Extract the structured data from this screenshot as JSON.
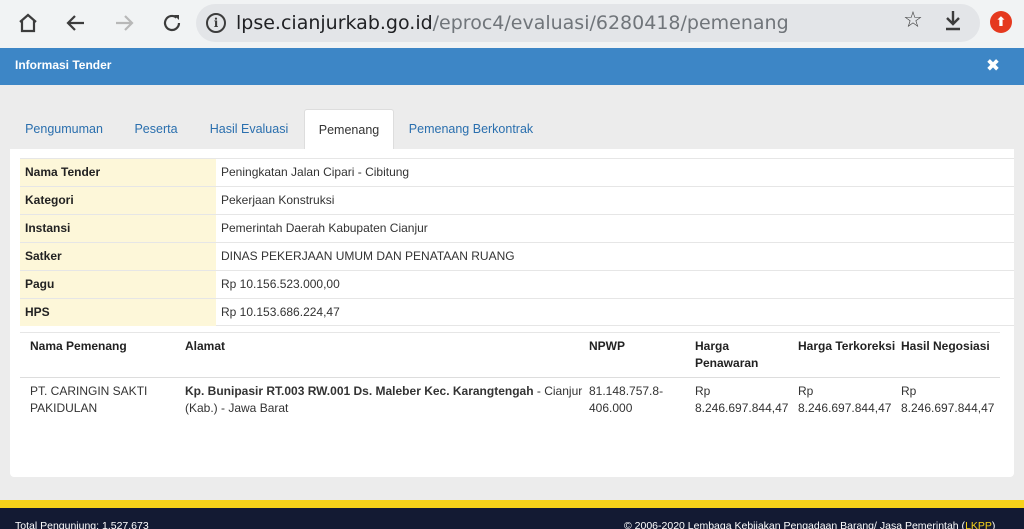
{
  "browser": {
    "url_host": "lpse.cianjurkab.go.id",
    "url_path": "/eproc4/evaluasi/6280418/pemenang",
    "icons": [
      "home-icon",
      "back-icon",
      "forward-icon",
      "reload-icon",
      "info-icon",
      "star-icon",
      "download-icon",
      "opera-icon"
    ]
  },
  "modal": {
    "title": "Informasi Tender",
    "close_glyph": "✖",
    "header_color": "#3d86c6"
  },
  "tabs": [
    {
      "label": "Pengumuman",
      "active": false
    },
    {
      "label": "Peserta",
      "active": false
    },
    {
      "label": "Hasil Evaluasi",
      "active": false
    },
    {
      "label": "Pemenang",
      "active": true
    },
    {
      "label": "Pemenang Berkontrak",
      "active": false
    }
  ],
  "info": [
    {
      "label": "Nama Tender",
      "value": "Peningkatan Jalan Cipari - Cibitung"
    },
    {
      "label": "Kategori",
      "value": "Pekerjaan Konstruksi"
    },
    {
      "label": "Instansi",
      "value": "Pemerintah Daerah Kabupaten Cianjur"
    },
    {
      "label": "Satker",
      "value": "DINAS PEKERJAAN UMUM DAN PENATAAN RUANG"
    },
    {
      "label": "Pagu",
      "value": "Rp 10.156.523.000,00"
    },
    {
      "label": "HPS",
      "value": "Rp 10.153.686.224,47"
    }
  ],
  "winners": {
    "headers": {
      "name": "Nama Pemenang",
      "address": "Alamat",
      "npwp": "NPWP",
      "offer_1": "Harga",
      "offer_2": "Penawaran",
      "corrected": "Harga Terkoreksi",
      "negotiated": "Hasil Negosiasi"
    },
    "rows": [
      {
        "name_1": "PT. CARINGIN SAKTI",
        "name_2": "PAKIDULAN",
        "address_bold": "Kp. Bunipasir RT.003 RW.001 Ds. Maleber Kec. Karangtengah",
        "address_rest_1": " - Cianjur",
        "address_rest_2": "(Kab.) - Jawa Barat",
        "npwp_1": "81.148.757.8-",
        "npwp_2": "406.000",
        "offer_cur": "Rp",
        "offer_val": "8.246.697.844,47",
        "corrected_cur": "Rp",
        "corrected_val": "8.246.697.844,47",
        "negotiated_cur": "Rp",
        "negotiated_val": "8.246.697.844,47"
      }
    ]
  },
  "footer": {
    "visitors": "Total Pengunjung: 1.527.673",
    "copyright": "© 2006-2020 Lembaga Kebijakan Pengadaan Barang/ Jasa Pemerintah (",
    "lkpp": "LKPP",
    "copyright_end": ")"
  }
}
